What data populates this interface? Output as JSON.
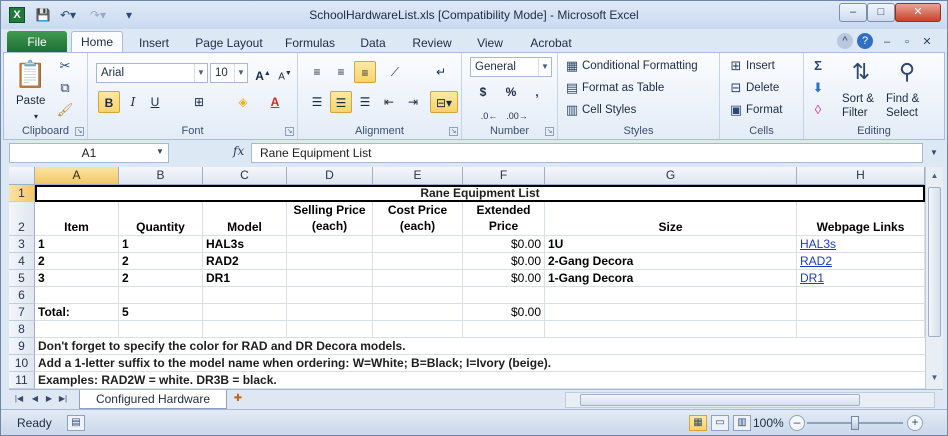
{
  "window": {
    "title": "SchoolHardwareList.xls  [Compatibility Mode]  -  Microsoft Excel",
    "app_icon": "X",
    "buttons": {
      "minimize": "–",
      "maximize": "□",
      "close": "✕"
    }
  },
  "ribbon_tabs": [
    "File",
    "Home",
    "Insert",
    "Page Layout",
    "Formulas",
    "Data",
    "Review",
    "View",
    "Acrobat"
  ],
  "active_tab": "Home",
  "groups": {
    "clipboard": {
      "label": "Clipboard",
      "paste": "Paste"
    },
    "font": {
      "label": "Font",
      "font_name": "Arial",
      "font_size": "10",
      "bold": "B",
      "italic": "I",
      "underline": "U"
    },
    "alignment": {
      "label": "Alignment"
    },
    "number": {
      "label": "Number",
      "format": "General",
      "currency": "$",
      "percent": "%",
      "comma": ","
    },
    "styles": {
      "label": "Styles",
      "conditional": "Conditional Formatting",
      "format_table": "Format as Table",
      "cell_styles": "Cell Styles"
    },
    "cells": {
      "label": "Cells",
      "insert": "Insert",
      "delete": "Delete",
      "format": "Format"
    },
    "editing": {
      "label": "Editing",
      "sort": "Sort &",
      "sort2": "Filter",
      "find": "Find &",
      "find2": "Select"
    }
  },
  "formula_bar": {
    "name_box": "A1",
    "fx": "fx",
    "content": "Rane Equipment List"
  },
  "columns": [
    "A",
    "B",
    "C",
    "D",
    "E",
    "F",
    "G",
    "H"
  ],
  "rows": [
    "1",
    "2",
    "3",
    "4",
    "5",
    "6",
    "7",
    "8",
    "9",
    "10",
    "11"
  ],
  "sheet": {
    "title": "Rane Equipment List",
    "headers": {
      "item": "Item",
      "quantity": "Quantity",
      "model": "Model",
      "selling1": "Selling Price",
      "selling2": "(each)",
      "cost1": "Cost Price",
      "cost2": "(each)",
      "ext1": "Extended",
      "ext2": "Price",
      "size": "Size",
      "links": "Webpage Links"
    },
    "data_rows": [
      {
        "item": "1",
        "qty": "1",
        "model": "HAL3s",
        "ext": "$0.00",
        "size": "1U",
        "link": "HAL3s"
      },
      {
        "item": "2",
        "qty": "2",
        "model": "RAD2",
        "ext": "$0.00",
        "size": "2-Gang Decora",
        "link": "RAD2"
      },
      {
        "item": "3",
        "qty": "2",
        "model": "DR1",
        "ext": "$0.00",
        "size": "1-Gang Decora",
        "link": "DR1"
      }
    ],
    "total_label": "Total:",
    "total_qty": "5",
    "total_ext": "$0.00",
    "notes": [
      "Don't forget to specify the color for RAD and DR Decora models.",
      "Add a 1-letter suffix to the model name when ordering: W=White; B=Black; I=Ivory (beige).",
      "Examples: RAD2W = white. DR3B = black."
    ]
  },
  "sheet_tab": "Configured Hardware",
  "status": {
    "ready": "Ready",
    "zoom": "100%"
  }
}
